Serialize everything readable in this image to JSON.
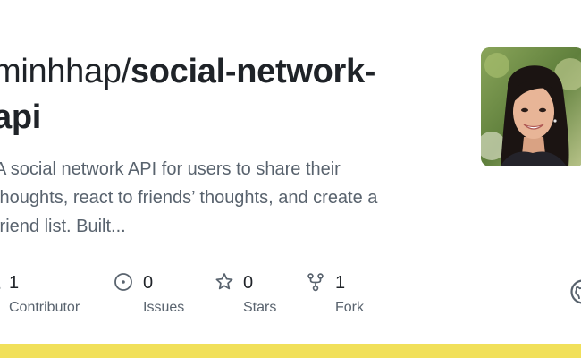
{
  "repo": {
    "owner": "minhhap",
    "separator": "/",
    "name": "social-network-api",
    "name_line1": "social-network-",
    "name_line2": "api"
  },
  "description": {
    "line1": "A social network API for users to share their",
    "line2": "thoughts, react to friends’ thoughts, and create a",
    "line3": "friend list. Built..."
  },
  "stats": [
    {
      "icon": "people-icon",
      "count": "1",
      "label": "Contributor"
    },
    {
      "icon": "issue-icon",
      "count": "0",
      "label": "Issues"
    },
    {
      "icon": "star-icon",
      "count": "0",
      "label": "Stars"
    },
    {
      "icon": "fork-icon",
      "count": "1",
      "label": "Fork"
    }
  ],
  "colors": {
    "title": "#1f2328",
    "muted": "#59636e",
    "bottom_bar": "#f1e05a"
  },
  "avatar": {
    "icon": "avatar-photo"
  },
  "brand": {
    "icon": "github-mark-icon"
  }
}
